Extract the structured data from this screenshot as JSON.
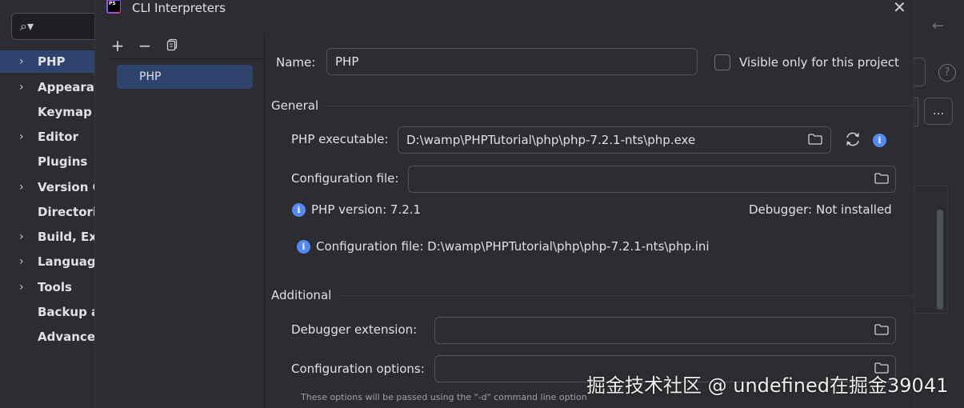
{
  "settings_sidebar": {
    "items": [
      {
        "label": "PHP",
        "expandable": true,
        "selected": true
      },
      {
        "label": "Appearance",
        "expandable": true
      },
      {
        "label": "Keymap",
        "expandable": false
      },
      {
        "label": "Editor",
        "expandable": true
      },
      {
        "label": "Plugins",
        "expandable": false
      },
      {
        "label": "Version Control",
        "expandable": true
      },
      {
        "label": "Directories",
        "expandable": false
      },
      {
        "label": "Build, Execution, Deployment",
        "expandable": true
      },
      {
        "label": "Languages & Frameworks",
        "expandable": true
      },
      {
        "label": "Tools",
        "expandable": true
      },
      {
        "label": "Backup and Sync",
        "expandable": false
      },
      {
        "label": "Advanced Settings",
        "expandable": false
      }
    ]
  },
  "background_right": {
    "more_label": "..."
  },
  "dialog": {
    "title": "CLI Interpreters",
    "interpreters": [
      "PHP"
    ],
    "name_label": "Name:",
    "name_value": "PHP",
    "visible_only_label": "Visible only for this project",
    "general_section": "General",
    "php_executable_label": "PHP executable:",
    "php_executable_value": "D:\\wamp\\PHPTutorial\\php\\php-7.2.1-nts\\php.exe",
    "config_file_label": "Configuration file:",
    "config_file_value": "",
    "php_version": "PHP version: 7.2.1",
    "debugger_label": "Debugger:",
    "debugger_value": "Not installed",
    "config_file_info": "Configuration file: D:\\wamp\\PHPTutorial\\php\\php-7.2.1-nts\\php.ini",
    "additional_section": "Additional",
    "debugger_extension_label": "Debugger extension:",
    "debugger_extension_value": "",
    "config_options_label": "Configuration options:",
    "config_options_value": "",
    "config_options_hint": "These options will be passed using the \"-d\" command line option"
  },
  "watermark": "掘金技术社区 @ undefined在掘金39041",
  "colors": {
    "background": "#1e1f22",
    "panel": "#2b2d30",
    "selection": "#2e436e",
    "info_blue": "#548af7",
    "border": "#4e5157"
  }
}
